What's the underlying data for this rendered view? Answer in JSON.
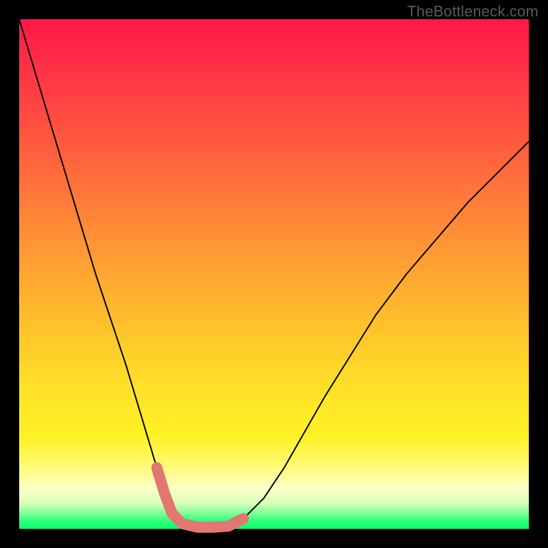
{
  "watermark": "TheBottleneck.com",
  "colors": {
    "frame": "#000000",
    "gradient_top": "#ff1846",
    "gradient_bottom": "#0aff6e",
    "curve": "#000000",
    "marker": "#e27670"
  },
  "chart_data": {
    "type": "line",
    "title": "",
    "xlabel": "",
    "ylabel": "",
    "xlim": [
      0,
      100
    ],
    "ylim": [
      0,
      100
    ],
    "grid": false,
    "legend": false,
    "x": [
      0,
      3,
      6,
      9,
      12,
      15,
      18,
      21,
      24,
      27,
      28.5,
      30,
      32,
      35,
      38,
      41,
      44,
      48,
      52,
      56,
      60,
      65,
      70,
      76,
      82,
      88,
      94,
      100
    ],
    "y": [
      100,
      90,
      80,
      70,
      60,
      50,
      41,
      32,
      22,
      12,
      7,
      3,
      1,
      0.3,
      0.3,
      0.5,
      2,
      6,
      12,
      19,
      26,
      34,
      42,
      50,
      57,
      64,
      70,
      76
    ],
    "marker_x": [
      27,
      28.5,
      30,
      32,
      35,
      38,
      41,
      43,
      44
    ],
    "marker_y": [
      12,
      7,
      3,
      1,
      0.3,
      0.3,
      0.5,
      1.5,
      2
    ],
    "annotations": []
  }
}
